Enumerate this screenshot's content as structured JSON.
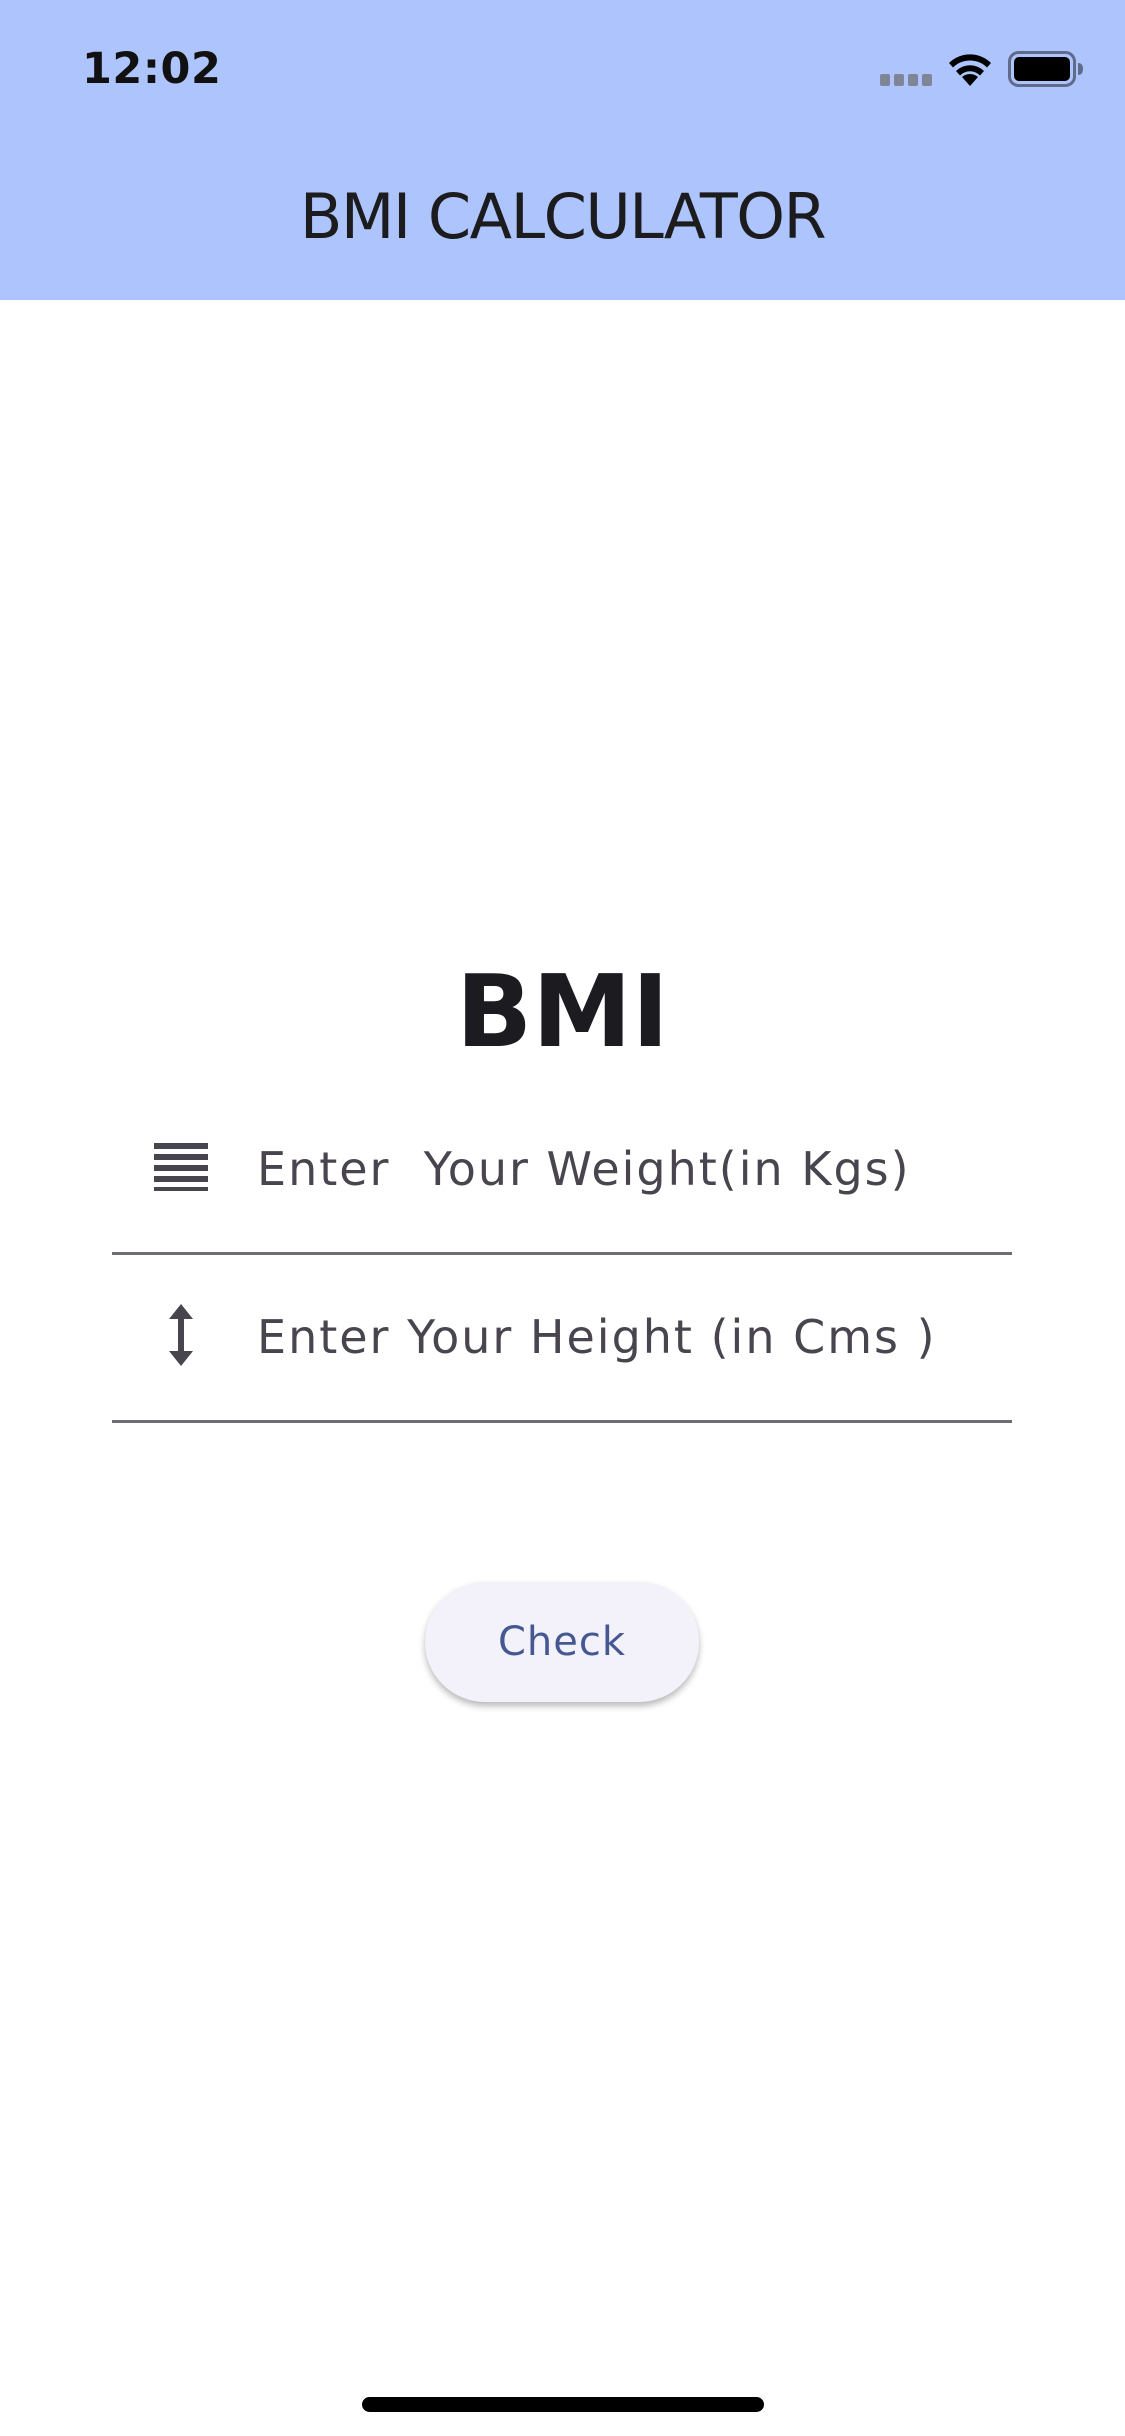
{
  "status_bar": {
    "time": "12:02",
    "icons": [
      "cellular-signal-icon",
      "wifi-icon",
      "battery-icon"
    ]
  },
  "app_bar": {
    "title": "BMI CALCULATOR",
    "background_color": "#aec4fd"
  },
  "main": {
    "title": "BMI",
    "weight_field": {
      "icon": "weight-lines-icon",
      "placeholder": "Enter  Your Weight(in Kgs)",
      "value": ""
    },
    "height_field": {
      "icon": "vertical-arrows-icon",
      "placeholder": "Enter Your Height (in Cms )",
      "value": ""
    },
    "check_button": {
      "label": "Check",
      "text_color": "#465892"
    }
  }
}
